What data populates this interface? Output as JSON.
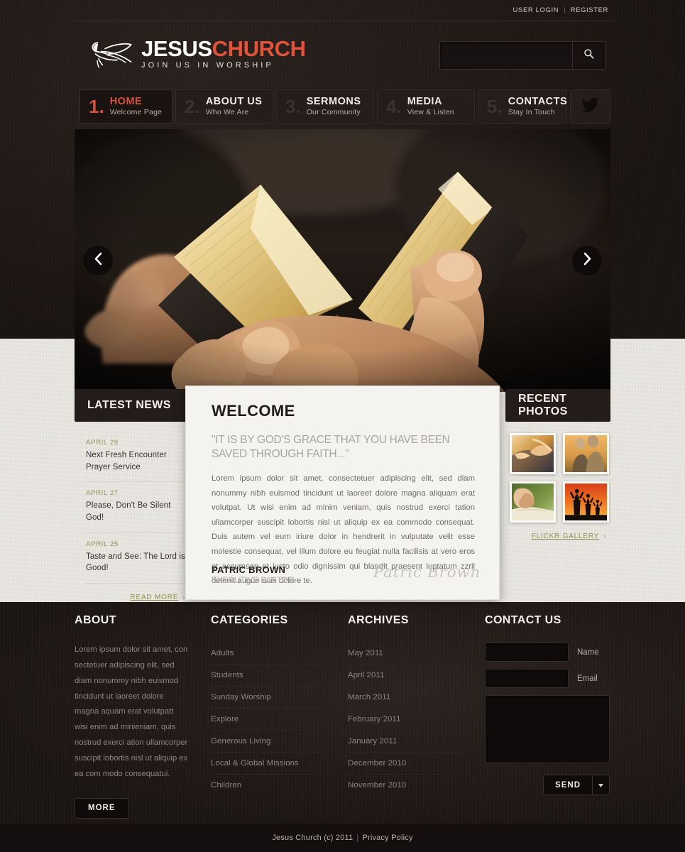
{
  "topbar": {
    "user_login": "USER LOGIN",
    "separator": "|",
    "register": "REGISTER"
  },
  "header": {
    "logo_word_1": "JESUS",
    "logo_word_2": "CHURCH",
    "tagline": "JOIN US IN WORSHIP",
    "logo_icon": "dove-icon",
    "search_placeholder": "",
    "search_value": "",
    "search_icon": "search-icon"
  },
  "nav": {
    "items": [
      {
        "num": "1.",
        "label": "HOME",
        "sub": "Welcome Page",
        "active": true
      },
      {
        "num": "2.",
        "label": "ABOUT US",
        "sub": "Who We Are",
        "active": false
      },
      {
        "num": "3.",
        "label": "SERMONS",
        "sub": "Our Community",
        "active": false
      },
      {
        "num": "4.",
        "label": "MEDIA",
        "sub": "View & Listen",
        "active": false
      },
      {
        "num": "5.",
        "label": "CONTACTS",
        "sub": "Stay In Touch",
        "active": false
      }
    ],
    "social_icon": "twitter-bird-icon"
  },
  "hero": {
    "alt": "hands-holding-open-bible",
    "prev_icon": "chevron-left-icon",
    "next_icon": "chevron-right-icon"
  },
  "news": {
    "title": "LATEST NEWS",
    "items": [
      {
        "date": "APRIL 29",
        "title": "Next Fresh Encounter Prayer Service"
      },
      {
        "date": "APRIL 27",
        "title": "Please, Don't Be Silent God!"
      },
      {
        "date": "APRIL 25",
        "title": "Taste and See: The Lord is Good!"
      }
    ],
    "read_more": "READ MORE",
    "chevron": "›"
  },
  "welcome": {
    "title": "WELCOME",
    "quote": "\"IT IS BY GOD'S GRACE THAT YOU HAVE BEEN SAVED THROUGH FAITH...\"",
    "body": "Lorem ipsum dolor sit amet, consectetuer adipiscing elit, sed diam nonummy nibh euismod tincidunt ut laoreet dolore magna aliquam erat volutpat. Ut wisi enim ad minim veniam, quis nostrud exerci tation ullamcorper suscipit lobortis nisl ut aliquip ex ea commodo consequat. Duis autem vel eum iriure dolor in hendrerit in vulputate velit esse molestie consequat, vel illum dolore eu feugiat nulla facilisis at vero eros et accumsan et iusto odio dignissim qui blandit praesent luptatum zzril delenit augue duis dolore te.",
    "signer_name": "PATRIC BROWN",
    "signer_role": "EXECUTIVE PASTOR",
    "signature": "Patric Brown"
  },
  "photos": {
    "title": "RECENT PHOTOS",
    "thumbs": [
      {
        "alt": "reaching-hands-photo"
      },
      {
        "alt": "elderly-couple-sunset-photo"
      },
      {
        "alt": "praying-hands-on-bible-photo"
      },
      {
        "alt": "family-silhouette-sunset-photo"
      }
    ],
    "gallery_link": "FLICKR GALLERY",
    "chevron": "›"
  },
  "footer": {
    "about": {
      "title": "ABOUT",
      "text": "Lorem ipsum dolor sit amet, con sectetuer adipiscing elit, sed diam nonummy nibh euismod tincidunt ut laoreet dolore magna aquam erat volutpatt wisi enim ad minieniam, quis nostrud exerci ation ullamcorper suscipit lobortis nisl ut aliquip ex ea com modo consequatui.",
      "more_label": "MORE"
    },
    "categories": {
      "title": "CATEGORIES",
      "items": [
        "Adults",
        "Students",
        "Sunday Worship",
        "Explore",
        "Generous Living",
        "Local & Global Missions",
        "Children"
      ]
    },
    "archives": {
      "title": "ARCHIVES",
      "items": [
        "May 2011",
        "April 2011",
        "March 2011",
        "February 2011",
        "January 2011",
        "December 2010",
        "November 2010"
      ]
    },
    "contact": {
      "title": "CONTACT US",
      "name_label": "Name",
      "email_label": "Email",
      "name_value": "",
      "email_value": "",
      "message_value": "",
      "send_label": "SEND",
      "caret_icon": "caret-down-icon"
    }
  },
  "copyright": {
    "text": "Jesus Church (c) 2011",
    "separator": "|",
    "privacy": "Privacy Policy"
  },
  "colors": {
    "accent": "#e0543a",
    "link_green": "#8e9255",
    "dark_bg": "#1d1715",
    "light_bg": "#e9e7e0",
    "card_bg": "#f4f3ef"
  }
}
